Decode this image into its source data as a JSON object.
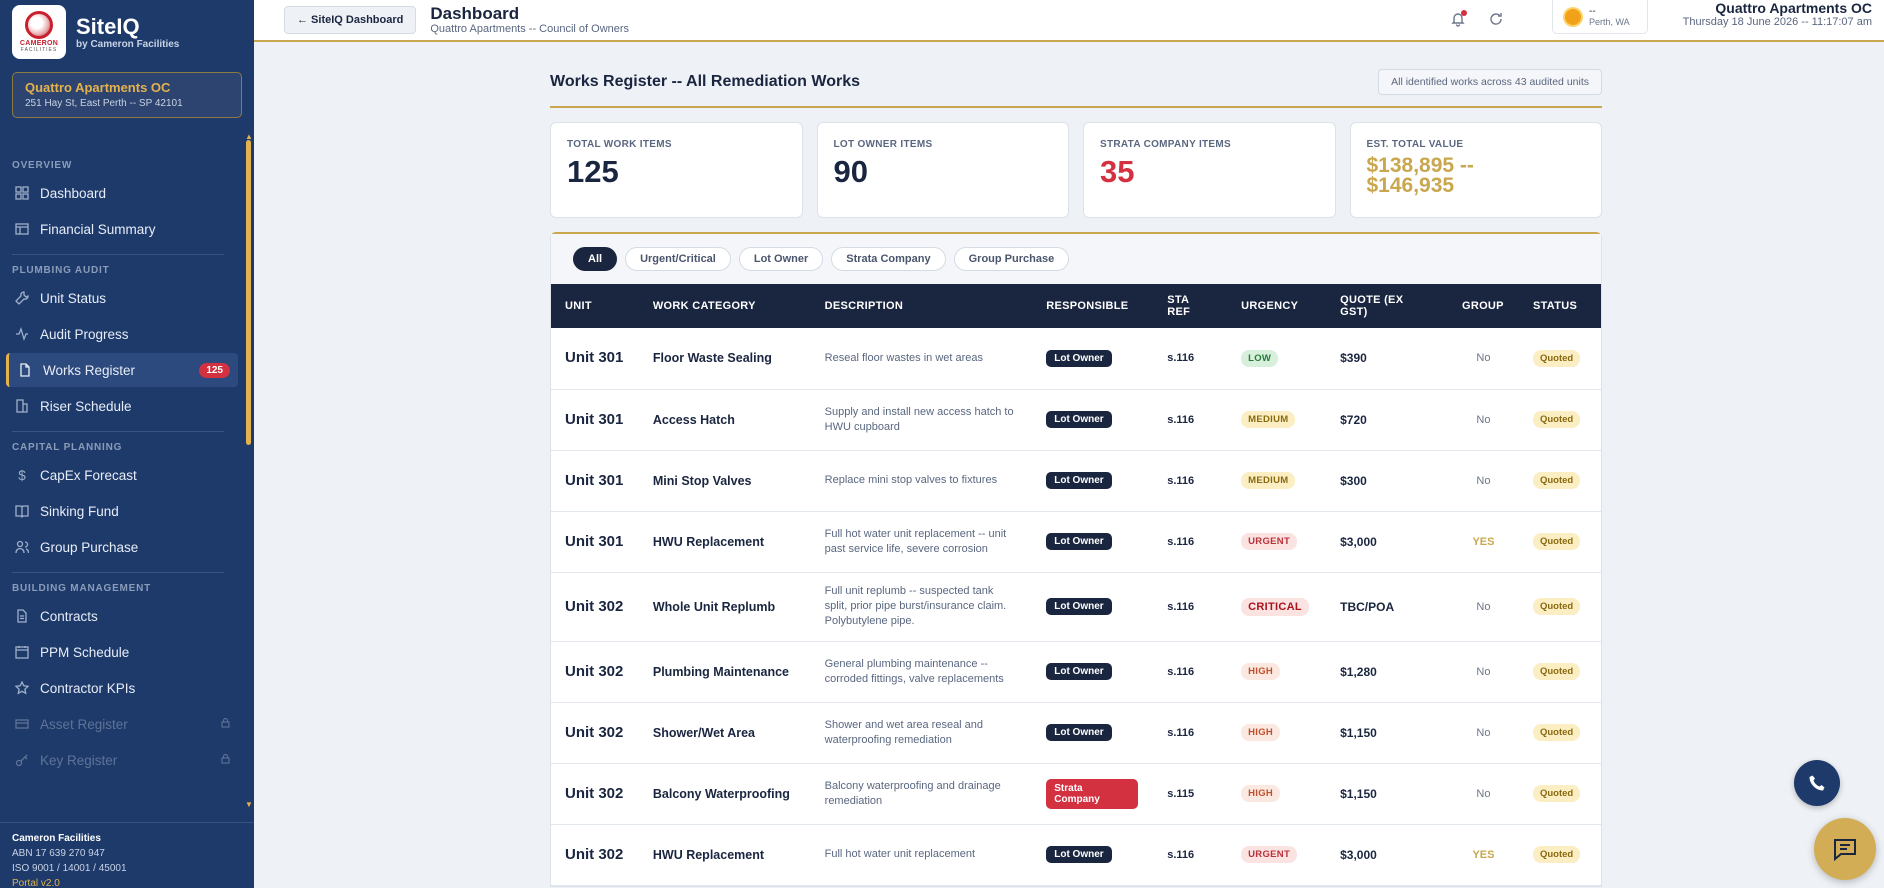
{
  "brand": {
    "name": "SiteIQ",
    "sub": "by Cameron Facilities",
    "logo_text": "CAMERON",
    "logo_sub": "FACILITIES"
  },
  "site": {
    "name": "Quattro Apartments OC",
    "address": "251 Hay St, East Perth -- SP 42101"
  },
  "nav": {
    "sections": [
      {
        "label": "OVERVIEW",
        "items": [
          {
            "label": "Dashboard",
            "icon": "grid-icon"
          },
          {
            "label": "Financial Summary",
            "icon": "bank-icon"
          }
        ]
      },
      {
        "label": "PLUMBING AUDIT",
        "items": [
          {
            "label": "Unit Status",
            "icon": "wrench-icon"
          },
          {
            "label": "Audit Progress",
            "icon": "activity-icon"
          },
          {
            "label": "Works Register",
            "icon": "file-icon",
            "badge": "125",
            "active": true
          },
          {
            "label": "Riser Schedule",
            "icon": "building-icon"
          }
        ]
      },
      {
        "label": "CAPITAL PLANNING",
        "items": [
          {
            "label": "CapEx Forecast",
            "icon": "dollar-icon"
          },
          {
            "label": "Sinking Fund",
            "icon": "book-icon"
          },
          {
            "label": "Group Purchase",
            "icon": "users-icon"
          }
        ]
      },
      {
        "label": "BUILDING MANAGEMENT",
        "items": [
          {
            "label": "Contracts",
            "icon": "document-icon"
          },
          {
            "label": "PPM Schedule",
            "icon": "calendar-icon"
          },
          {
            "label": "Contractor KPIs",
            "icon": "star-icon"
          },
          {
            "label": "Asset Register",
            "icon": "card-icon",
            "disabled": true
          },
          {
            "label": "Key Register",
            "icon": "key-icon",
            "disabled": true
          }
        ]
      }
    ]
  },
  "footer": {
    "company": "Cameron Facilities",
    "abn": "ABN 17 639 270 947",
    "iso": "ISO 9001 / 14001 / 45001",
    "version": "Portal v2.0"
  },
  "topbar": {
    "back_label": "← SiteIQ Dashboard",
    "title": "Dashboard",
    "subtitle": "Quattro Apartments -- Council of Owners",
    "weather_value": "--",
    "weather_location": "Perth, WA",
    "right_title": "Quattro Apartments OC",
    "datetime": "Thursday 18 June 2026 -- 11:17:07 am"
  },
  "main": {
    "title": "Works Register -- All Remediation Works",
    "pill": "All identified works across 43 audited units",
    "stats": [
      {
        "label": "TOTAL WORK ITEMS",
        "value": "125"
      },
      {
        "label": "LOT OWNER ITEMS",
        "value": "90"
      },
      {
        "label": "STRATA COMPANY ITEMS",
        "value": "35"
      },
      {
        "label": "EST. TOTAL VALUE",
        "value_line1": "$138,895 --",
        "value_line2": "$146,935"
      }
    ],
    "filters": [
      "All",
      "Urgent/Critical",
      "Lot Owner",
      "Strata Company",
      "Group Purchase"
    ],
    "active_filter": "All",
    "columns": [
      "UNIT",
      "WORK CATEGORY",
      "DESCRIPTION",
      "RESPONSIBLE",
      "STA REF",
      "URGENCY",
      "QUOTE (EX GST)",
      "GROUP",
      "STATUS"
    ],
    "rows": [
      {
        "unit": "Unit 301",
        "category": "Floor Waste Sealing",
        "description": "Reseal floor wastes in wet areas",
        "responsible": "Lot Owner",
        "sta": "s.116",
        "urgency": "LOW",
        "quote": "$390",
        "group": "No",
        "status": "Quoted"
      },
      {
        "unit": "Unit 301",
        "category": "Access Hatch",
        "description": "Supply and install new access hatch to HWU cupboard",
        "responsible": "Lot Owner",
        "sta": "s.116",
        "urgency": "MEDIUM",
        "quote": "$720",
        "group": "No",
        "status": "Quoted"
      },
      {
        "unit": "Unit 301",
        "category": "Mini Stop Valves",
        "description": "Replace mini stop valves to fixtures",
        "responsible": "Lot Owner",
        "sta": "s.116",
        "urgency": "MEDIUM",
        "quote": "$300",
        "group": "No",
        "status": "Quoted"
      },
      {
        "unit": "Unit 301",
        "category": "HWU Replacement",
        "description": "Full hot water unit replacement -- unit past service life, severe corrosion",
        "responsible": "Lot Owner",
        "sta": "s.116",
        "urgency": "URGENT",
        "quote": "$3,000",
        "group": "YES",
        "status": "Quoted"
      },
      {
        "unit": "Unit 302",
        "category": "Whole Unit Replumb",
        "description": "Full unit replumb -- suspected tank split, prior pipe burst/insurance claim. Polybutylene pipe.",
        "responsible": "Lot Owner",
        "sta": "s.116",
        "urgency": "CRITICAL",
        "quote": "TBC/POA",
        "group": "No",
        "status": "Quoted"
      },
      {
        "unit": "Unit 302",
        "category": "Plumbing Maintenance",
        "description": "General plumbing maintenance -- corroded fittings, valve replacements",
        "responsible": "Lot Owner",
        "sta": "s.116",
        "urgency": "HIGH",
        "quote": "$1,280",
        "group": "No",
        "status": "Quoted"
      },
      {
        "unit": "Unit 302",
        "category": "Shower/Wet Area",
        "description": "Shower and wet area reseal and waterproofing remediation",
        "responsible": "Lot Owner",
        "sta": "s.116",
        "urgency": "HIGH",
        "quote": "$1,150",
        "group": "No",
        "status": "Quoted"
      },
      {
        "unit": "Unit 302",
        "category": "Balcony Waterproofing",
        "description": "Balcony waterproofing and drainage remediation",
        "responsible": "Strata Company",
        "sta": "s.115",
        "urgency": "HIGH",
        "quote": "$1,150",
        "group": "No",
        "status": "Quoted"
      },
      {
        "unit": "Unit 302",
        "category": "HWU Replacement",
        "description": "Full hot water unit replacement",
        "responsible": "Lot Owner",
        "sta": "s.116",
        "urgency": "URGENT",
        "quote": "$3,000",
        "group": "YES",
        "status": "Quoted"
      }
    ]
  },
  "colors": {
    "navy": "#1e3a6b",
    "gold": "#c9a74f",
    "red": "#d33040"
  }
}
